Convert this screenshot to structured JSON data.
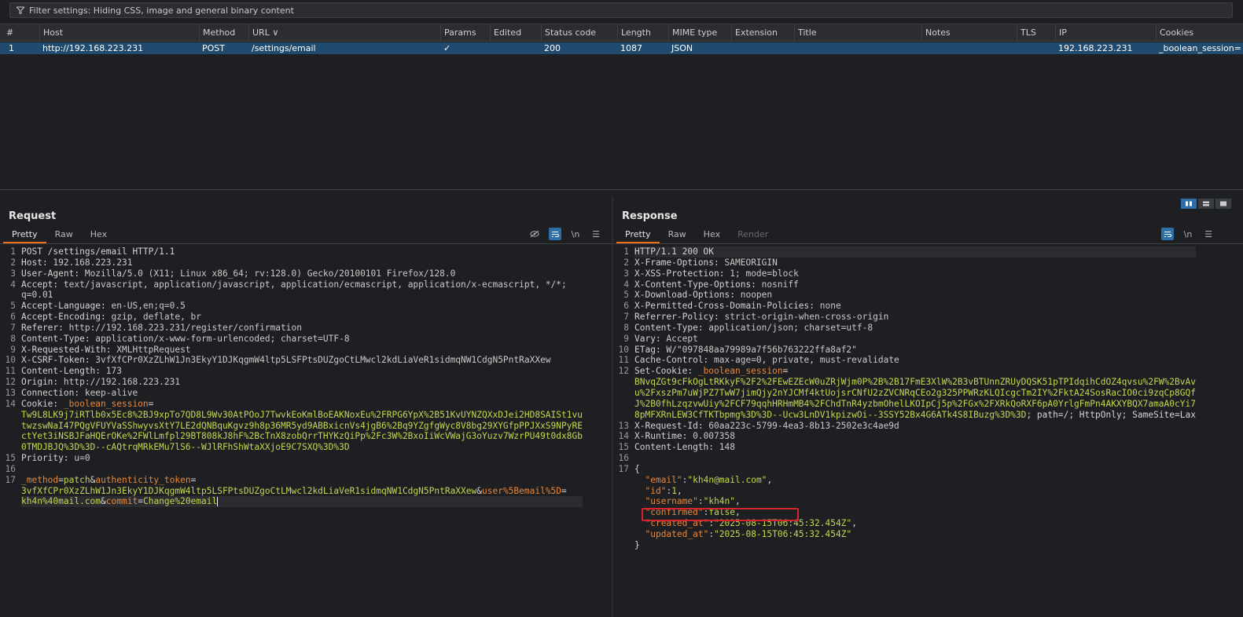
{
  "filter": {
    "text": "Filter settings: Hiding CSS, image and general binary content"
  },
  "table": {
    "headers": [
      "#",
      "Host",
      "Method",
      "URL",
      "Params",
      "Edited",
      "Status code",
      "Length",
      "MIME type",
      "Extension",
      "Title",
      "Notes",
      "TLS",
      "IP",
      "Cookies"
    ],
    "row": {
      "num": "1",
      "host": "http://192.168.223.231",
      "method": "POST",
      "url": "/settings/email",
      "params": "✓",
      "status": "200",
      "length": "1087",
      "mime": "JSON",
      "ip": "192.168.223.231",
      "cookies": "_boolean_session="
    }
  },
  "request": {
    "title": "Request",
    "tabs": [
      "Pretty",
      "Raw",
      "Hex"
    ],
    "lines": [
      {
        "n": "1",
        "parts": [
          [
            "k",
            "POST /settings/email HTTP/1.1"
          ]
        ]
      },
      {
        "n": "2",
        "parts": [
          [
            "k",
            "Host: "
          ],
          [
            "v",
            "192.168.223.231"
          ]
        ]
      },
      {
        "n": "3",
        "parts": [
          [
            "k",
            "User-Agent: "
          ],
          [
            "v",
            "Mozilla/5.0 (X11; Linux x86_64; rv:128.0) Gecko/20100101 Firefox/128.0"
          ]
        ]
      },
      {
        "n": "4",
        "parts": [
          [
            "k",
            "Accept: "
          ],
          [
            "v",
            "text/javascript, application/javascript, application/ecmascript, application/x-ecmascript, */*;"
          ]
        ]
      },
      {
        "n": "",
        "parts": [
          [
            "v",
            "q=0.01"
          ]
        ]
      },
      {
        "n": "5",
        "parts": [
          [
            "k",
            "Accept-Language: "
          ],
          [
            "v",
            "en-US,en;q=0.5"
          ]
        ]
      },
      {
        "n": "6",
        "parts": [
          [
            "k",
            "Accept-Encoding: "
          ],
          [
            "v",
            "gzip, deflate, br"
          ]
        ]
      },
      {
        "n": "7",
        "parts": [
          [
            "k",
            "Referer: "
          ],
          [
            "v",
            "http://192.168.223.231/register/confirmation"
          ]
        ]
      },
      {
        "n": "8",
        "parts": [
          [
            "k",
            "Content-Type: "
          ],
          [
            "v",
            "application/x-www-form-urlencoded; charset=UTF-8"
          ]
        ]
      },
      {
        "n": "9",
        "parts": [
          [
            "k",
            "X-Requested-With: "
          ],
          [
            "v",
            "XMLHttpRequest"
          ]
        ]
      },
      {
        "n": "10",
        "parts": [
          [
            "k",
            "X-CSRF-Token: "
          ],
          [
            "v",
            "3vfXfCPr0XzZLhW1Jn3EkyY1DJKqgmW4ltp5LSFPtsDUZgoCtLMwcl2kdLiaVeR1sidmqNW1CdgN5PntRaXXew"
          ]
        ]
      },
      {
        "n": "11",
        "parts": [
          [
            "k",
            "Content-Length: "
          ],
          [
            "v",
            "173"
          ]
        ]
      },
      {
        "n": "12",
        "parts": [
          [
            "k",
            "Origin: "
          ],
          [
            "v",
            "http://192.168.223.231"
          ]
        ]
      },
      {
        "n": "13",
        "parts": [
          [
            "k",
            "Connection: "
          ],
          [
            "v",
            "keep-alive"
          ]
        ]
      },
      {
        "n": "14",
        "parts": [
          [
            "k",
            "Cookie: "
          ],
          [
            "p",
            "_boolean_session"
          ],
          [
            "k",
            "="
          ]
        ]
      },
      {
        "n": "",
        "parts": [
          [
            "g",
            "Tw9L8LK9j7iRTlb0x5Ec8%2BJ9xpTo7QD8L9Wv30AtPOoJ7TwvkEoKmlBoEAKNoxEu%2FRPG6YpX%2B51KvUYNZQXxDJei2HD8SAISt1vu"
          ]
        ]
      },
      {
        "n": "",
        "parts": [
          [
            "g",
            "twzswNaI47PQgVFUYVaSShwyvsXtY7LE2dQNBquKgvz9h8p36MR5yd9ABBxicnVs4jgB6%2Bq9YZgfgWyc8V8bg29XYGfpPPJXxS9NPyRE"
          ]
        ]
      },
      {
        "n": "",
        "parts": [
          [
            "g",
            "ctYet3iNSBJFaHQErOKe%2FWlLmfpl29BT808kJ8hF%2BcTnX8zobQrrTHYKzQiPp%2Fc3W%2BxoIiWcVWajG3oYuzv7WzrPU49t0dx8Gb"
          ]
        ]
      },
      {
        "n": "",
        "parts": [
          [
            "g",
            "0TMDJBJQ%3D%3D--cAQtrqMRkEMu7lS6--WJlRFhShWtaXXjoE9C7SXQ%3D%3D"
          ]
        ]
      },
      {
        "n": "15",
        "parts": [
          [
            "k",
            "Priority: "
          ],
          [
            "v",
            "u=0"
          ]
        ]
      },
      {
        "n": "16",
        "parts": []
      },
      {
        "n": "17",
        "parts": [
          [
            "p",
            "_method"
          ],
          [
            "k",
            "="
          ],
          [
            "g",
            "patch"
          ],
          [
            "k",
            "&"
          ],
          [
            "p",
            "authenticity_token"
          ],
          [
            "k",
            "="
          ]
        ]
      },
      {
        "n": "",
        "parts": [
          [
            "g",
            "3vfXfCPr0XzZLhW1Jn3EkyY1DJKqgmW4ltp5LSFPtsDUZgoCtLMwcl2kdLiaVeR1sidmqNW1CdgN5PntRaXXew"
          ],
          [
            "k",
            "&"
          ],
          [
            "p",
            "user%5Bemail%5D"
          ],
          [
            "k",
            "="
          ]
        ]
      },
      {
        "n": "",
        "parts": [
          [
            "g",
            "kh4n%40mail.com"
          ],
          [
            "k",
            "&"
          ],
          [
            "p",
            "commit"
          ],
          [
            "k",
            "="
          ],
          [
            "g",
            "Change%20email"
          ]
        ]
      }
    ]
  },
  "response": {
    "title": "Response",
    "tabs": [
      "Pretty",
      "Raw",
      "Hex",
      "Render"
    ],
    "lines": [
      {
        "n": "1",
        "parts": [
          [
            "k",
            "HTTP/1.1 200 OK"
          ]
        ]
      },
      {
        "n": "2",
        "parts": [
          [
            "k",
            "X-Frame-Options: "
          ],
          [
            "v",
            "SAMEORIGIN"
          ]
        ]
      },
      {
        "n": "3",
        "parts": [
          [
            "k",
            "X-XSS-Protection: "
          ],
          [
            "v",
            "1; mode=block"
          ]
        ]
      },
      {
        "n": "4",
        "parts": [
          [
            "k",
            "X-Content-Type-Options: "
          ],
          [
            "v",
            "nosniff"
          ]
        ]
      },
      {
        "n": "5",
        "parts": [
          [
            "k",
            "X-Download-Options: "
          ],
          [
            "v",
            "noopen"
          ]
        ]
      },
      {
        "n": "6",
        "parts": [
          [
            "k",
            "X-Permitted-Cross-Domain-Policies: "
          ],
          [
            "v",
            "none"
          ]
        ]
      },
      {
        "n": "7",
        "parts": [
          [
            "k",
            "Referrer-Policy: "
          ],
          [
            "v",
            "strict-origin-when-cross-origin"
          ]
        ]
      },
      {
        "n": "8",
        "parts": [
          [
            "k",
            "Content-Type: "
          ],
          [
            "v",
            "application/json; charset=utf-8"
          ]
        ]
      },
      {
        "n": "9",
        "parts": [
          [
            "k",
            "Vary: "
          ],
          [
            "v",
            "Accept"
          ]
        ]
      },
      {
        "n": "10",
        "parts": [
          [
            "k",
            "ETag: "
          ],
          [
            "v",
            "W/\"097848aa79989a7f56b763222ffa8af2\""
          ]
        ]
      },
      {
        "n": "11",
        "parts": [
          [
            "k",
            "Cache-Control: "
          ],
          [
            "v",
            "max-age=0, private, must-revalidate"
          ]
        ]
      },
      {
        "n": "12",
        "parts": [
          [
            "k",
            "Set-Cookie: "
          ],
          [
            "p",
            "_boolean_session"
          ],
          [
            "k",
            "="
          ]
        ]
      },
      {
        "n": "",
        "parts": [
          [
            "g",
            "BNvqZGt9cFkOgLtRKkyF%2F2%2FEwEZEcW0uZRjWjm0P%2B%2B17FmE3XlW%2B3vBTUnnZRUyDQSK51pTPIdqihCdOZ4qvsu%2FW%2BvAv"
          ]
        ]
      },
      {
        "n": "",
        "parts": [
          [
            "g",
            "u%2FxszPm7uWjPZ7TwW7jimQjy2nYJCMf4ktUojsrCNfU2zZVCNRqCEo2g325PPWRzKLQIcgcTm2IY%2FktA24SosRacIO0ci9zqCp8GQf"
          ]
        ]
      },
      {
        "n": "",
        "parts": [
          [
            "g",
            "J%2B0fhLzqzvwUiy%2FCF79qqhHRHmMB4%2FChdTnR4yzbmOhelLKOIpCj5p%2FGx%2FXRkQoRXF6pA0YrlgFmPn4AKXYBQX7amaA0cYi7"
          ]
        ]
      },
      {
        "n": "",
        "parts": [
          [
            "g",
            "8pMFXRnLEW3CfTKTbpmg%3D%3D--Ucw3LnDV1kpizwOi--3SSY52Bx4G6ATk4S8IBuzg%3D%3D"
          ],
          [
            "k",
            "; path=/; HttpOnly; SameSite=Lax"
          ]
        ]
      },
      {
        "n": "13",
        "parts": [
          [
            "k",
            "X-Request-Id: "
          ],
          [
            "v",
            "60aa223c-5799-4ea3-8b13-2502e3c4ae9d"
          ]
        ]
      },
      {
        "n": "14",
        "parts": [
          [
            "k",
            "X-Runtime: "
          ],
          [
            "v",
            "0.007358"
          ]
        ]
      },
      {
        "n": "15",
        "parts": [
          [
            "k",
            "Content-Length: "
          ],
          [
            "v",
            "148"
          ]
        ]
      },
      {
        "n": "16",
        "parts": []
      },
      {
        "n": "17",
        "parts": [
          [
            "k",
            "{"
          ]
        ]
      },
      {
        "n": "",
        "parts": [
          [
            "k",
            "  "
          ],
          [
            "p",
            "\"email\""
          ],
          [
            "k",
            ":"
          ],
          [
            "g",
            "\"kh4n@mail.com\""
          ],
          [
            "k",
            ","
          ]
        ]
      },
      {
        "n": "",
        "parts": [
          [
            "k",
            "  "
          ],
          [
            "p",
            "\"id\""
          ],
          [
            "k",
            ":"
          ],
          [
            "g",
            "1"
          ],
          [
            "k",
            ","
          ]
        ]
      },
      {
        "n": "",
        "parts": [
          [
            "k",
            "  "
          ],
          [
            "p",
            "\"username\""
          ],
          [
            "k",
            ":"
          ],
          [
            "g",
            "\"kh4n\""
          ],
          [
            "k",
            ","
          ]
        ]
      },
      {
        "n": "",
        "parts": [
          [
            "k",
            "  "
          ],
          [
            "p",
            "\"confirmed\""
          ],
          [
            "k",
            ":"
          ],
          [
            "g",
            "false"
          ],
          [
            "k",
            ","
          ]
        ]
      },
      {
        "n": "",
        "parts": [
          [
            "k",
            "  "
          ],
          [
            "p",
            "\"created_at\""
          ],
          [
            "k",
            ":"
          ],
          [
            "g",
            "\"2025-08-15T06:45:32.454Z\""
          ],
          [
            "k",
            ","
          ]
        ]
      },
      {
        "n": "",
        "parts": [
          [
            "k",
            "  "
          ],
          [
            "p",
            "\"updated_at\""
          ],
          [
            "k",
            ":"
          ],
          [
            "g",
            "\"2025-08-15T06:45:32.454Z\""
          ]
        ]
      },
      {
        "n": "",
        "parts": [
          [
            "k",
            "}"
          ]
        ]
      }
    ]
  },
  "colors": {
    "accent": "#e8711a",
    "selected_row": "#214b6e",
    "highlight_box": "#d6232d"
  }
}
